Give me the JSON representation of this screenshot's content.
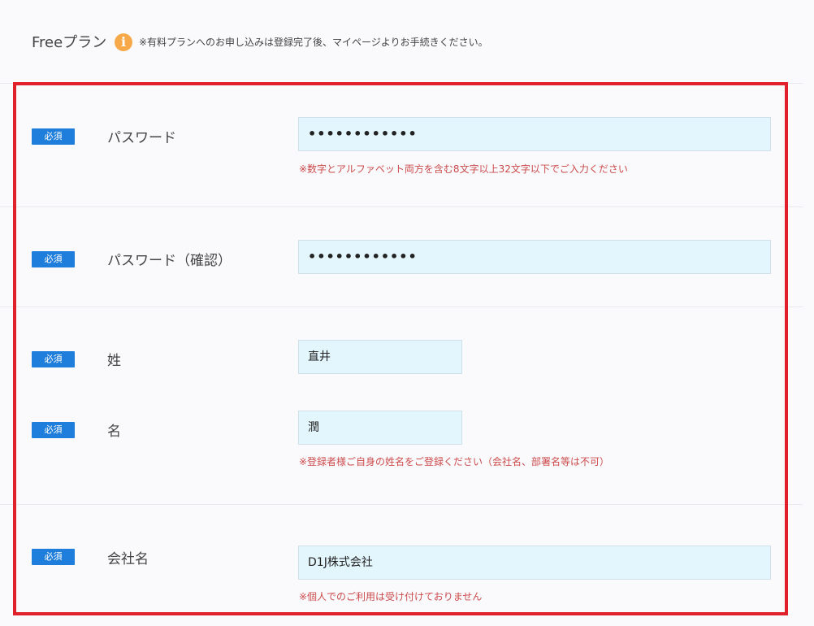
{
  "plan": {
    "label": "Freeプラン",
    "info_icon_glyph": "i",
    "note": "※有料プランへのお申し込みは登録完了後、マイページよりお手続きください。"
  },
  "required_badge": "必須",
  "fields": {
    "password": {
      "label": "パスワード",
      "value": "••••••••••••",
      "hint": "※数字とアルファベット両方を含む8文字以上32文字以下でご入力ください"
    },
    "password_confirm": {
      "label": "パスワード（確認）",
      "value": "••••••••••••"
    },
    "last_name": {
      "label": "姓",
      "value": "直井"
    },
    "first_name": {
      "label": "名",
      "value": "潤",
      "hint": "※登録者様ご自身の姓名をご登録ください（会社名、部署名等は不可）"
    },
    "company": {
      "label": "会社名",
      "value": "D1J株式会社",
      "hint": "※個人でのご利用は受け付けておりません"
    }
  },
  "colors": {
    "badge": "#1f7edb",
    "hint": "#cc4b4b",
    "input_bg": "#e3f6fd",
    "highlight": "#e0202b",
    "info_icon": "#f7a94a"
  }
}
